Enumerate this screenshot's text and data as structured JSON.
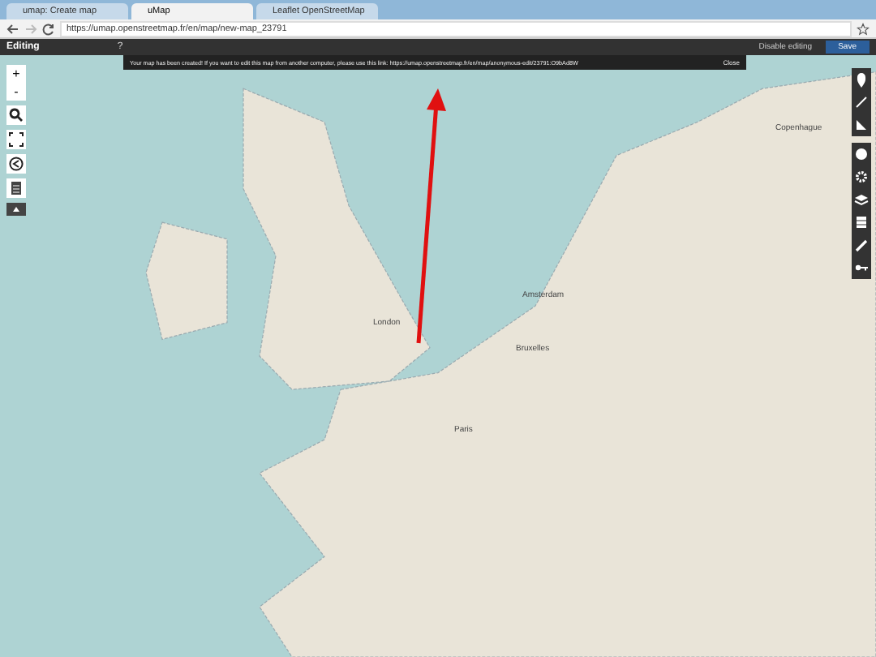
{
  "browser": {
    "tabs": [
      {
        "title": "umap: Create map",
        "selected": false
      },
      {
        "title": "uMap",
        "selected": true
      },
      {
        "title": "Leaflet OpenStreetMap",
        "selected": false
      }
    ],
    "url": "https://umap.openstreetmap.fr/en/map/new-map_23791"
  },
  "toolbar": {
    "mode": "Editing",
    "help": "?",
    "disable_editing": "Disable editing",
    "save": "Save"
  },
  "message": {
    "text": "Your map has been created! If you want to edit this map from another computer, please use this link: https://umap.openstreetmap.fr/en/map/anonymous-edit/23791:O9bAd8W",
    "close": "Close"
  },
  "map": {
    "labels": [
      {
        "text": "Copenhague"
      },
      {
        "text": "Amsterdam"
      },
      {
        "text": "London"
      },
      {
        "text": "Bruxelles"
      },
      {
        "text": "Paris"
      }
    ],
    "zoom_in": "+",
    "zoom_out": "-"
  }
}
